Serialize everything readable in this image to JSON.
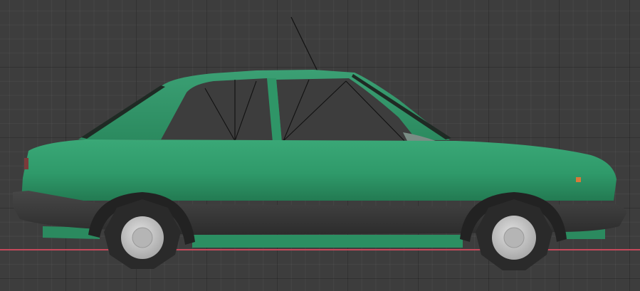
{
  "viewport": {
    "background": "#3d3d3d",
    "grid_minor_color": "#444444",
    "grid_major_color": "#2f2f2f",
    "axis_color": "#c4485a"
  },
  "model": {
    "object": "car",
    "body_color": "#2e9a6a",
    "bumper_color": "#3a3a3a",
    "wheel_color": "#2a2a2a",
    "hubcap_color": "#c8c8c8",
    "indicator_color": "#d8783a"
  }
}
